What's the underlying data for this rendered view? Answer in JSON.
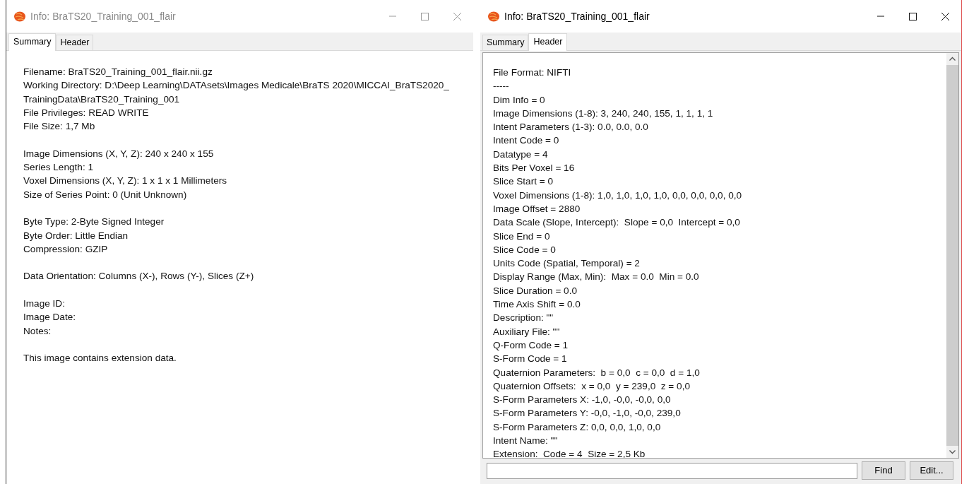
{
  "windows": [
    {
      "title": "Info: BraTS20_Training_001_flair",
      "active": false,
      "kind": "summary",
      "tabs": [
        {
          "label": "Summary",
          "selected": true
        },
        {
          "label": "Header",
          "selected": false
        }
      ],
      "groups": [
        [
          "Filename: BraTS20_Training_001_flair.nii.gz",
          "Working Directory: D:\\Deep Learning\\DATAsets\\Images Medicale\\BraTS 2020\\MICCAI_BraTS2020_TrainingData\\BraTS20_Training_001",
          "File Privileges: READ WRITE",
          "File Size: 1,7 Mb"
        ],
        [
          "Image Dimensions (X, Y, Z): 240 x 240 x 155",
          "Series Length: 1",
          "Voxel Dimensions (X, Y, Z): 1 x 1 x 1 Millimeters",
          "Size of Series Point: 0 (Unit Unknown)"
        ],
        [
          "Byte Type: 2-Byte Signed Integer",
          "Byte Order: Little Endian",
          "Compression: GZIP"
        ],
        [
          "Data Orientation: Columns (X-), Rows (Y-), Slices (Z+)"
        ],
        [
          "Image ID:",
          "Image Date:",
          "Notes:"
        ],
        [
          "This image contains extension data."
        ]
      ]
    },
    {
      "title": "Info: BraTS20_Training_001_flair",
      "active": true,
      "kind": "header",
      "tabs": [
        {
          "label": "Summary",
          "selected": false
        },
        {
          "label": "Header",
          "selected": true
        }
      ],
      "groups": [
        [
          "File Format: NIFTI",
          "-----",
          "Dim Info = 0",
          "Image Dimensions (1-8): 3, 240, 240, 155, 1, 1, 1, 1",
          "Intent Parameters (1-3): 0.0, 0.0, 0.0",
          "Intent Code = 0",
          "Datatype = 4",
          "Bits Per Voxel = 16",
          "Slice Start = 0",
          "Voxel Dimensions (1-8): 1,0, 1,0, 1,0, 1,0, 0,0, 0,0, 0,0, 0,0",
          "Image Offset = 2880",
          "Data Scale (Slope, Intercept):  Slope = 0,0  Intercept = 0,0",
          "Slice End = 0",
          "Slice Code = 0",
          "Units Code (Spatial, Temporal) = 2",
          "Display Range (Max, Min):  Max = 0.0  Min = 0.0",
          "Slice Duration = 0.0",
          "Time Axis Shift = 0.0",
          "Description: \"\"",
          "Auxiliary File: \"\"",
          "Q-Form Code = 1",
          "S-Form Code = 1",
          "Quaternion Parameters:  b = 0,0  c = 0,0  d = 1,0",
          "Quaternion Offsets:  x = 0,0  y = 239,0  z = 0,0",
          "S-Form Parameters X: -1,0, -0,0, -0,0, 0,0",
          "S-Form Parameters Y: -0,0, -1,0, -0,0, 239,0",
          "S-Form Parameters Z: 0,0, 0,0, 1,0, 0,0",
          "Intent Name: \"\"",
          "Extension:  Code = 4  Size = 2,5 Kb"
        ]
      ],
      "buttons": [
        "Find",
        "Edit..."
      ]
    }
  ]
}
